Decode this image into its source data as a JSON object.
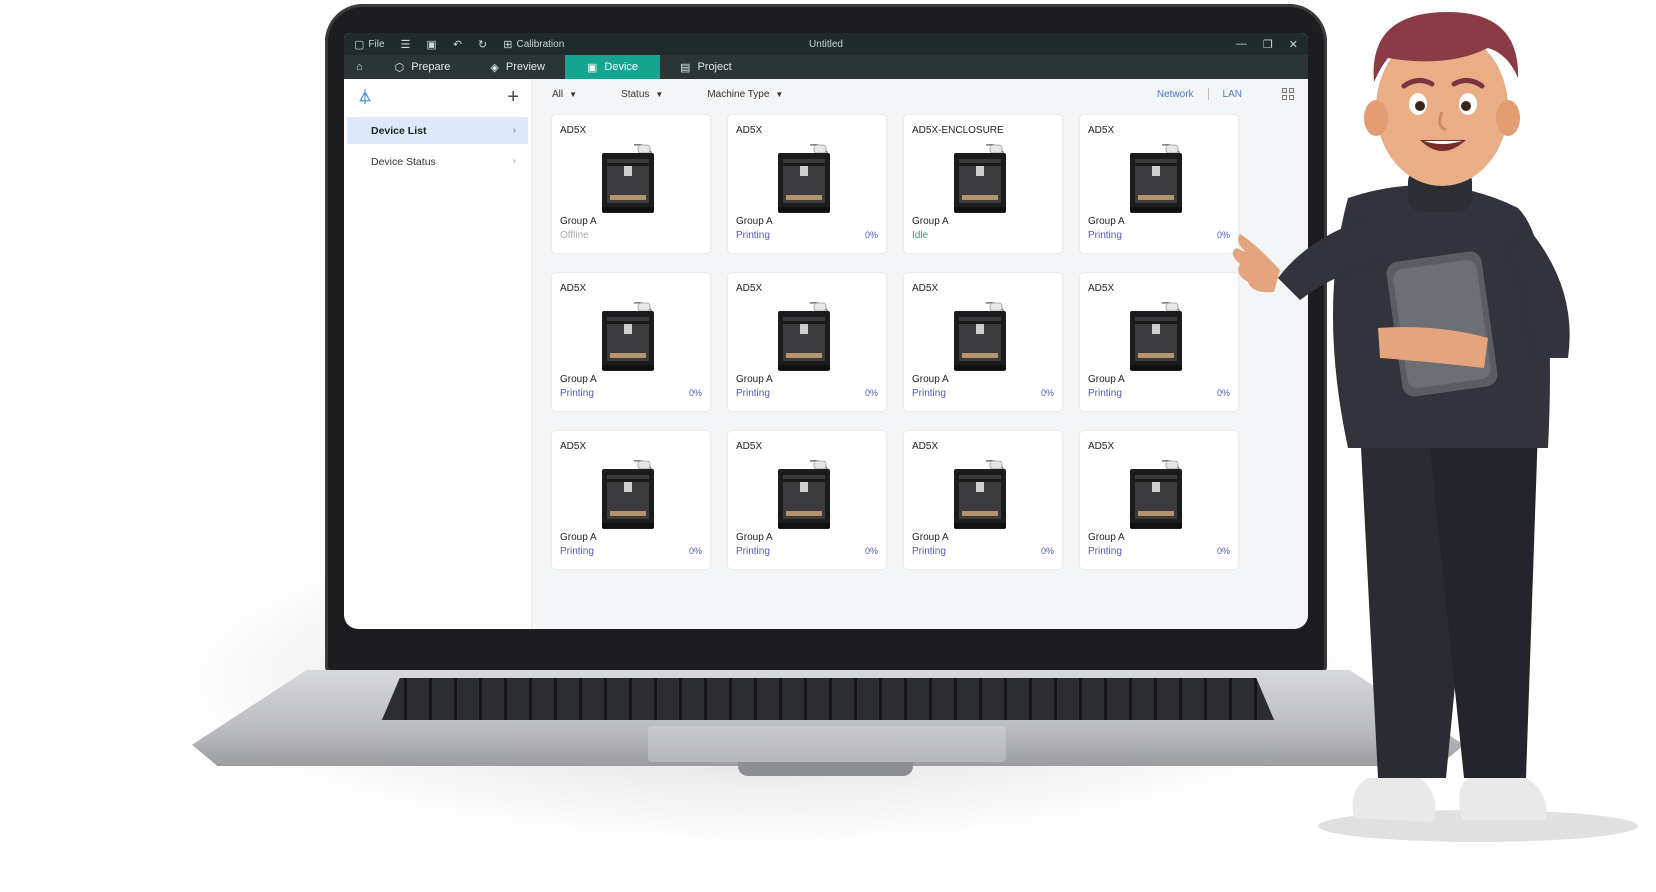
{
  "app": {
    "title": "Untitled",
    "titlebar": [
      {
        "icon": "file-icon",
        "label": "File"
      },
      {
        "icon": "menu-icon",
        "label": ""
      },
      {
        "icon": "save-icon",
        "label": ""
      },
      {
        "icon": "undo-icon",
        "label": ""
      },
      {
        "icon": "redo-icon",
        "label": ""
      },
      {
        "icon": "calibration-icon",
        "label": "Calibration"
      }
    ],
    "window_controls": [
      "minimize-icon",
      "restore-icon",
      "close-icon"
    ]
  },
  "tabs": [
    {
      "label": "Prepare",
      "icon": "cube-icon",
      "active": false
    },
    {
      "label": "Preview",
      "icon": "layers-icon",
      "active": false
    },
    {
      "label": "Device",
      "icon": "device-icon",
      "active": true
    },
    {
      "label": "Project",
      "icon": "project-icon",
      "active": false
    }
  ],
  "sidebar": {
    "items": [
      {
        "label": "Device List",
        "active": true
      },
      {
        "label": "Device Status",
        "active": false
      }
    ]
  },
  "filters": {
    "all": "All",
    "status": "Status",
    "machine_type": "Machine Type",
    "network": "Network",
    "lan": "LAN"
  },
  "devices": [
    {
      "model": "AD5X",
      "group": "Group A",
      "status": "Offline",
      "progress": ""
    },
    {
      "model": "AD5X",
      "group": "Group A",
      "status": "Printing",
      "progress": "0%"
    },
    {
      "model": "AD5X-ENCLOSURE",
      "group": "Group A",
      "status": "Idle",
      "progress": ""
    },
    {
      "model": "AD5X",
      "group": "Group A",
      "status": "Printing",
      "progress": "0%"
    },
    {
      "model": "AD5X",
      "group": "Group A",
      "status": "Printing",
      "progress": "0%"
    },
    {
      "model": "AD5X",
      "group": "Group A",
      "status": "Printing",
      "progress": "0%"
    },
    {
      "model": "AD5X",
      "group": "Group A",
      "status": "Printing",
      "progress": "0%"
    },
    {
      "model": "AD5X",
      "group": "Group A",
      "status": "Printing",
      "progress": "0%"
    },
    {
      "model": "AD5X",
      "group": "Group A",
      "status": "Printing",
      "progress": "0%"
    },
    {
      "model": "AD5X",
      "group": "Group A",
      "status": "Printing",
      "progress": "0%"
    },
    {
      "model": "AD5X",
      "group": "Group A",
      "status": "Printing",
      "progress": "0%"
    },
    {
      "model": "AD5X",
      "group": "Group A",
      "status": "Printing",
      "progress": "0%"
    }
  ],
  "colors": {
    "accent": "#16a591",
    "printing": "#4a58c9",
    "idle": "#2aa869",
    "offline": "#aaaaaa"
  }
}
